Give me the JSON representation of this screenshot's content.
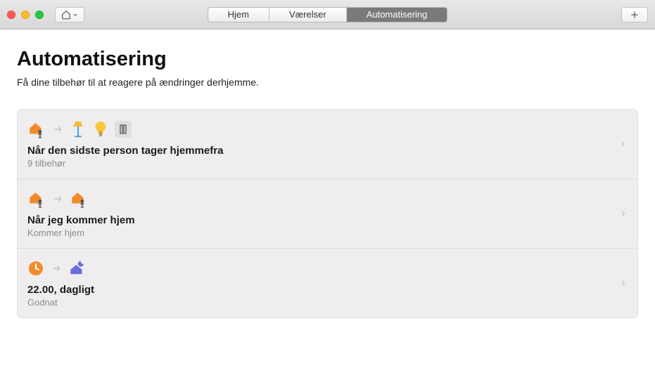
{
  "toolbar": {
    "tabs": [
      "Hjem",
      "Værelser",
      "Automatisering"
    ],
    "active_tab_index": 2
  },
  "page": {
    "title": "Automatisering",
    "subtitle": "Få dine tilbehør til at reagere på ændringer derhjemme."
  },
  "automations": [
    {
      "title": "Når den sidste person tager hjemmefra",
      "subtitle": "9 tilbehør",
      "trigger_icon": "house-leave",
      "result_icons": [
        "lamp",
        "bulb",
        "switch"
      ]
    },
    {
      "title": "Når jeg kommer hjem",
      "subtitle": "Kommer hjem",
      "trigger_icon": "house-leave",
      "result_icons": [
        "house-arrive"
      ]
    },
    {
      "title": "22.00, dagligt",
      "subtitle": "Godnat",
      "trigger_icon": "clock",
      "result_icons": [
        "house-night"
      ]
    }
  ]
}
